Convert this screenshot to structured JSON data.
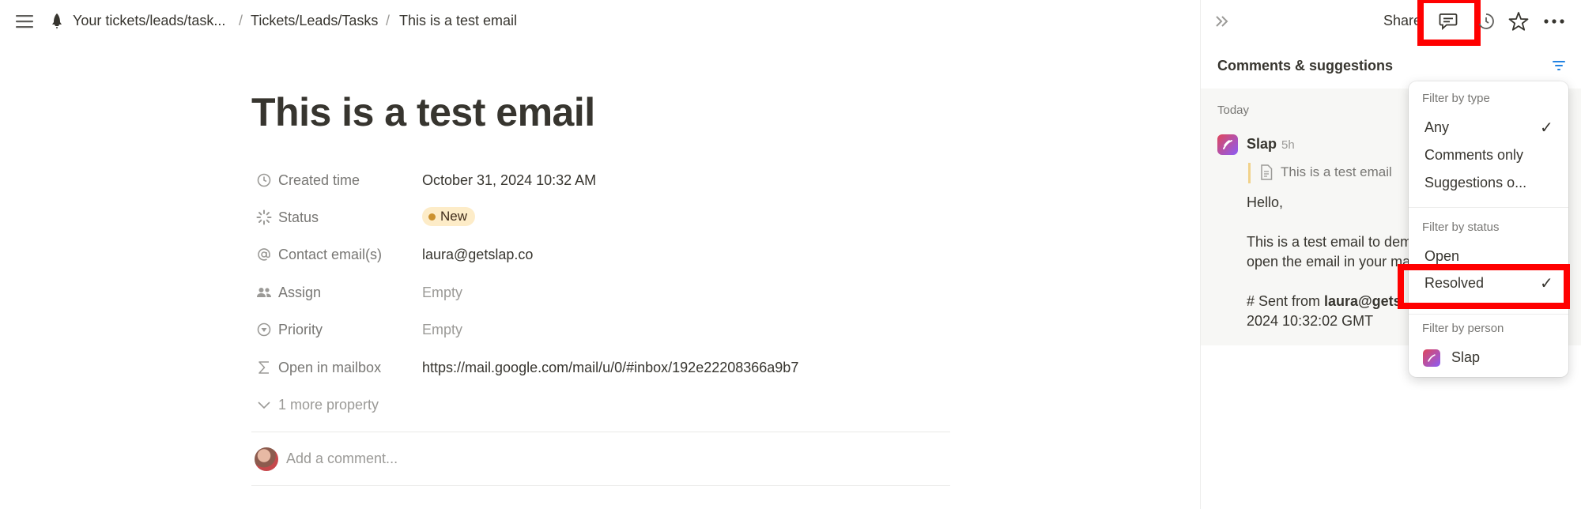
{
  "topbar": {
    "breadcrumb": [
      "Your tickets/leads/task...",
      "Tickets/Leads/Tasks",
      "This is a test email"
    ],
    "separator": "/",
    "share_label": "Share"
  },
  "page": {
    "title": "This is a test email",
    "properties": [
      {
        "label": "Created time",
        "value": "October 31, 2024 10:32 AM",
        "icon": "clock-icon"
      },
      {
        "label": "Status",
        "value": "New",
        "icon": "status-icon"
      },
      {
        "label": "Contact email(s)",
        "value": "laura@getslap.co",
        "icon": "at-icon"
      },
      {
        "label": "Assign",
        "value": "Empty",
        "icon": "people-icon"
      },
      {
        "label": "Priority",
        "value": "Empty",
        "icon": "priority-icon"
      },
      {
        "label": "Open in mailbox",
        "value": "https://mail.google.com/mail/u/0/#inbox/192e22208366a9b7",
        "icon": "sigma-icon"
      }
    ],
    "more_properties": "1 more property",
    "comment_placeholder": "Add a comment..."
  },
  "comments_panel": {
    "title": "Comments & suggestions",
    "group_label": "Today",
    "comment": {
      "author": "Slap",
      "time": "5h",
      "quote": "This is a test email",
      "body_line1": "Hello,",
      "body_line2": "This is a test email to dem",
      "body_line3": "open the email in your ma",
      "body_line4_prefix": "# Sent from ",
      "body_line4_bold": "laura@gets",
      "body_line5": "2024 10:32:02 GMT"
    }
  },
  "filter_menu": {
    "type_heading": "Filter by type",
    "type_options": [
      "Any",
      "Comments only",
      "Suggestions o..."
    ],
    "type_selected": "Any",
    "status_heading": "Filter by status",
    "status_options": [
      "Open",
      "Resolved"
    ],
    "status_selected": "Resolved",
    "person_heading": "Filter by person",
    "person_option": "Slap",
    "check": "✓"
  },
  "colors": {
    "highlight": "#ff0000",
    "status_badge_bg": "#fdecc8",
    "status_dot": "#cb912f",
    "filter_icon": "#2383e2"
  }
}
